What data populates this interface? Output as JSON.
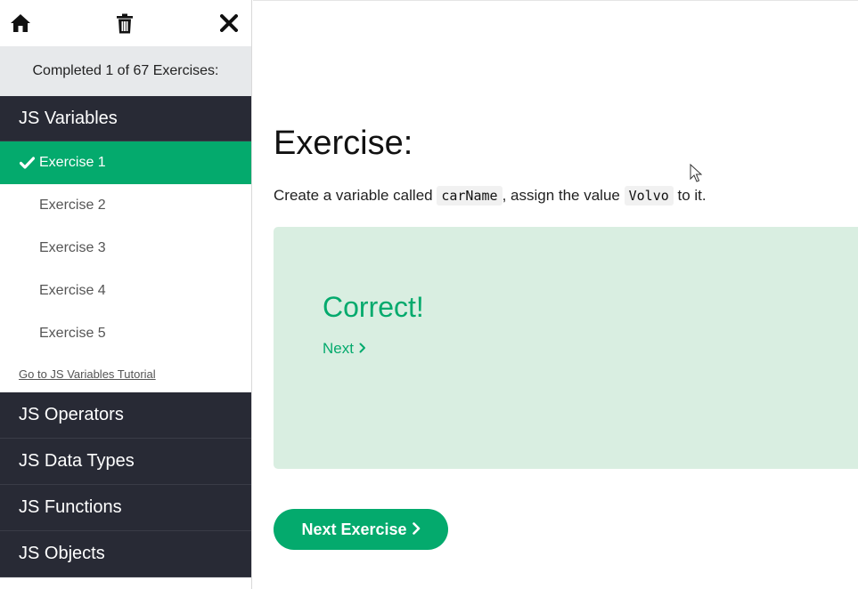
{
  "sidebar": {
    "progress_text": "Completed 1 of 67 Exercises:",
    "open_category": "JS Variables",
    "exercises": [
      {
        "label": "Exercise 1",
        "active": true
      },
      {
        "label": "Exercise 2",
        "active": false
      },
      {
        "label": "Exercise 3",
        "active": false
      },
      {
        "label": "Exercise 4",
        "active": false
      },
      {
        "label": "Exercise 5",
        "active": false
      }
    ],
    "tutorial_link": "Go to JS Variables Tutorial",
    "other_categories": [
      "JS Operators",
      "JS Data Types",
      "JS Functions",
      "JS Objects"
    ]
  },
  "main": {
    "title": "Exercise:",
    "instruction": {
      "part1": "Create a variable called",
      "code1": "carName",
      "part2": ", assign the value",
      "code2": "Volvo",
      "part3": "to it."
    },
    "result": {
      "message": "Correct!",
      "next_label": "Next"
    },
    "next_exercise_label": "Next Exercise"
  },
  "icons": {
    "home": "home-icon",
    "trash": "trash-icon",
    "close": "close-icon",
    "check": "check-icon",
    "chevron": "chevron-right-icon"
  },
  "colors": {
    "accent": "#04aa6d",
    "sidebar_dark": "#282a35",
    "progress_bg": "#e7e9eb",
    "result_bg": "#d9eee1"
  }
}
